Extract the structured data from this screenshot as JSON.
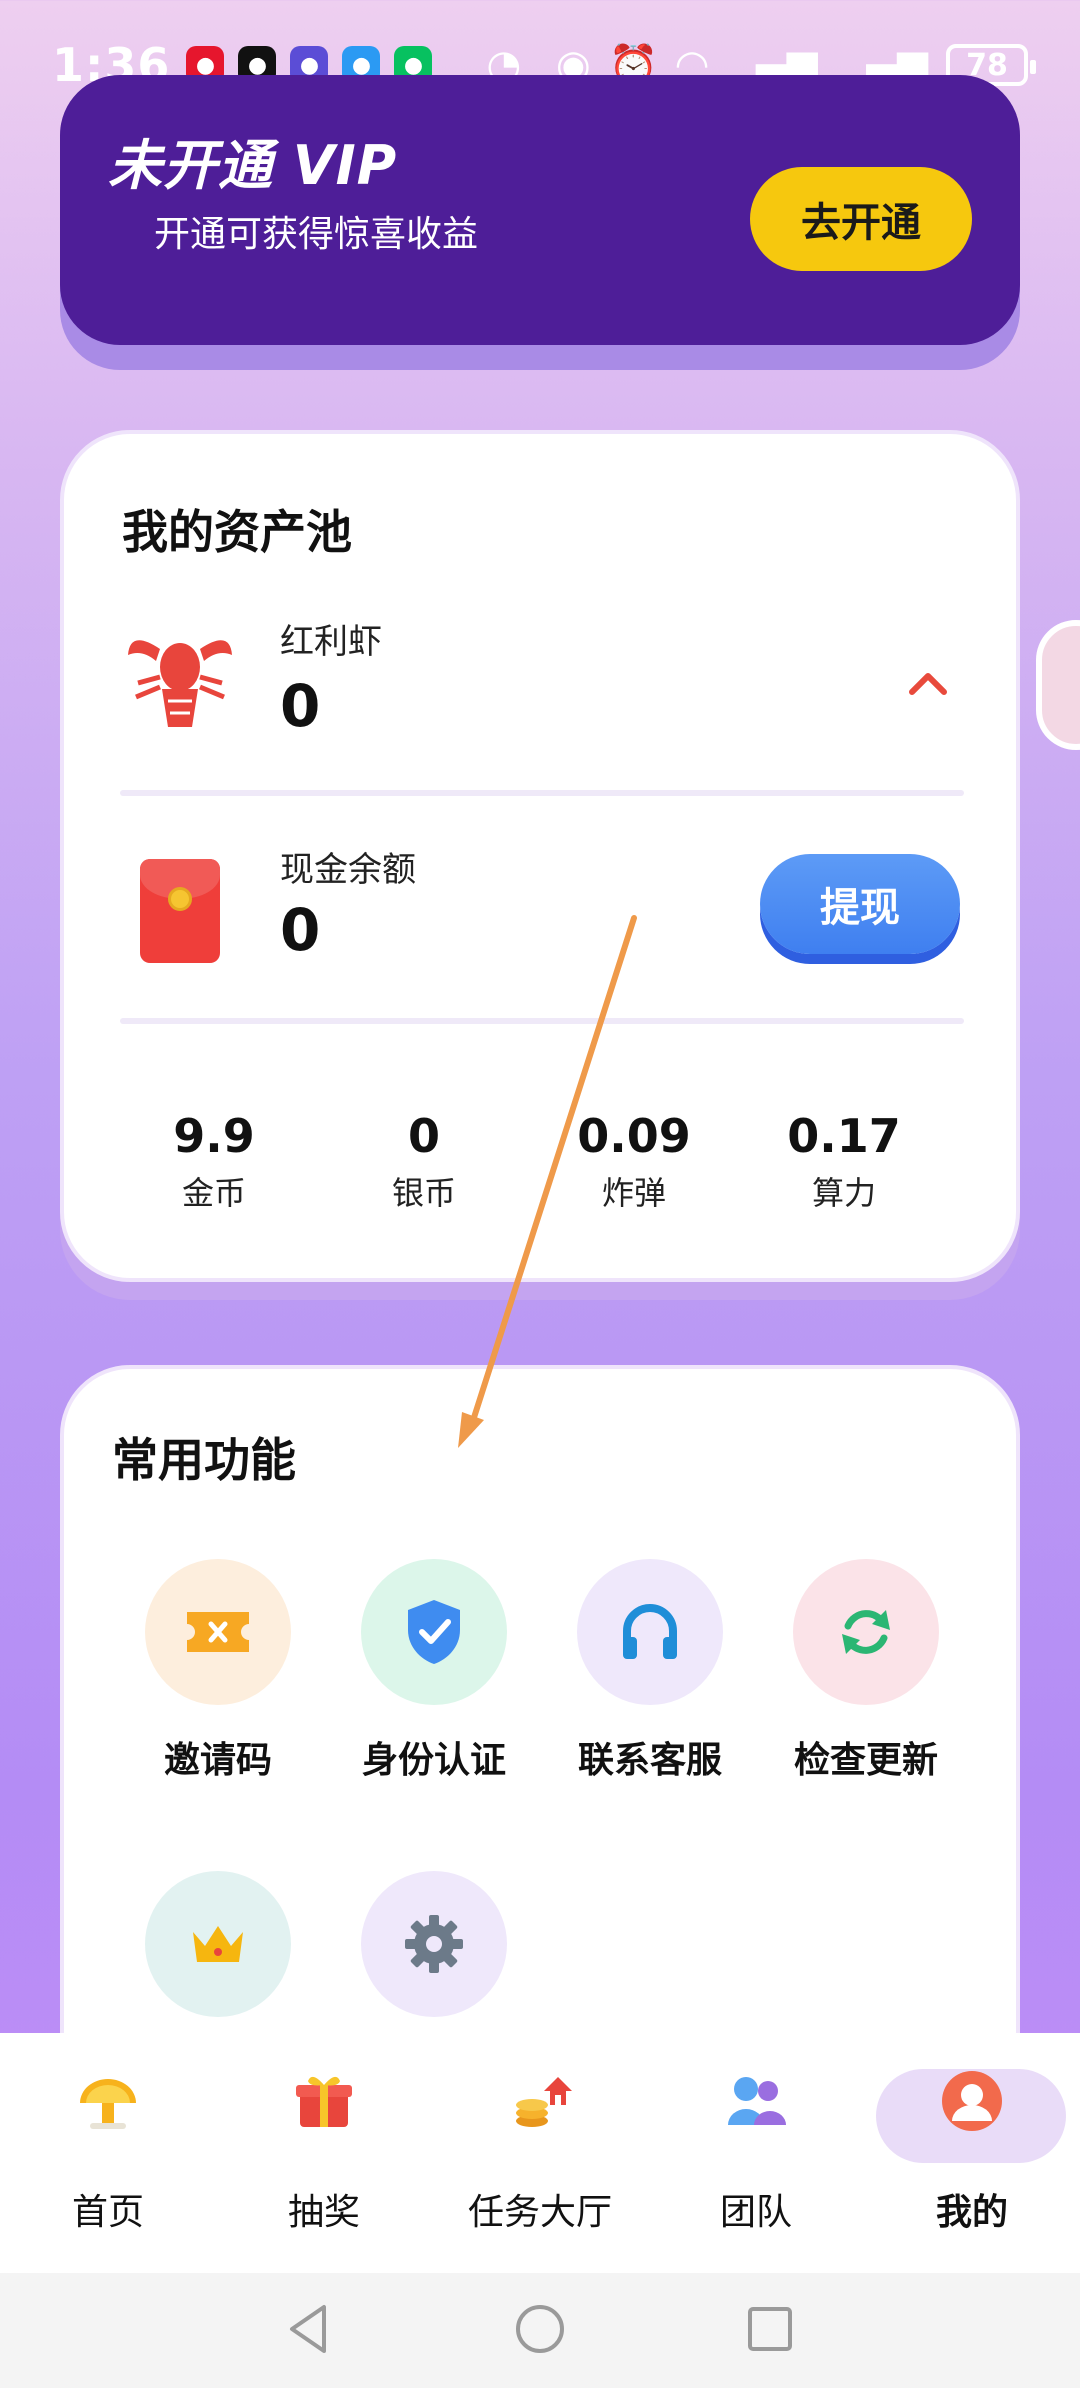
{
  "status_bar": {
    "time": "1:36",
    "battery": "78"
  },
  "vip": {
    "title": "未开通 VIP",
    "subtitle": "开通可获得惊喜收益",
    "button": "去开通"
  },
  "assets": {
    "title": "我的资产池",
    "shrimp_label": "红利虾",
    "shrimp_value": "0",
    "cash_label": "现金余额",
    "cash_value": "0",
    "withdraw_button": "提现",
    "stats": [
      {
        "value": "9.9",
        "label": "金币"
      },
      {
        "value": "0",
        "label": "银币"
      },
      {
        "value": "0.09",
        "label": "炸弹"
      },
      {
        "value": "0.17",
        "label": "算力"
      }
    ]
  },
  "functions": {
    "title": "常用功能",
    "items": [
      {
        "label": "邀请码",
        "icon": "ticket-icon",
        "color": "#f7a823",
        "bg": "#fdeedd"
      },
      {
        "label": "身份认证",
        "icon": "shield-check-icon",
        "color": "#3f8cf0",
        "bg": "#dcf6ea"
      },
      {
        "label": "联系客服",
        "icon": "headset-icon",
        "color": "#1f8ed8",
        "bg": "#efe8fb"
      },
      {
        "label": "检查更新",
        "icon": "refresh-icon",
        "color": "#2bb673",
        "bg": "#fbe3e8"
      },
      {
        "label": "",
        "icon": "crown-icon",
        "color": "#f6b60f",
        "bg": "#e2f2f1"
      },
      {
        "label": "",
        "icon": "gear-icon",
        "color": "#6c7a89",
        "bg": "#efe8fb"
      }
    ]
  },
  "bottom_nav": {
    "items": [
      {
        "label": "首页",
        "icon": "home-icon"
      },
      {
        "label": "抽奖",
        "icon": "gift-icon"
      },
      {
        "label": "任务大厅",
        "icon": "tasks-icon"
      },
      {
        "label": "团队",
        "icon": "team-icon"
      },
      {
        "label": "我的",
        "icon": "profile-icon",
        "active": true
      }
    ]
  }
}
